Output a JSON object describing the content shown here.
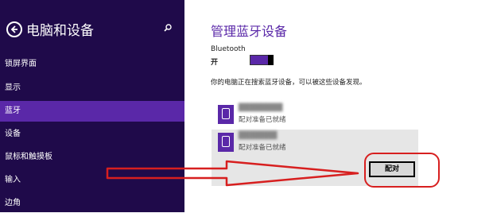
{
  "sidebar": {
    "title": "电脑和设备",
    "items": [
      {
        "label": "锁屏界面",
        "active": false
      },
      {
        "label": "显示",
        "active": false
      },
      {
        "label": "蓝牙",
        "active": true
      },
      {
        "label": "设备",
        "active": false
      },
      {
        "label": "鼠标和触摸板",
        "active": false
      },
      {
        "label": "输入",
        "active": false
      },
      {
        "label": "边角",
        "active": false
      }
    ]
  },
  "main": {
    "title": "管理蓝牙设备",
    "bluetooth_label": "Bluetooth",
    "bluetooth_state": "开",
    "status_text": "你的电脑正在搜索蓝牙设备，可以被这些设备发现。",
    "devices": [
      {
        "name": "████████",
        "status": "配对准备已就绪"
      },
      {
        "name": "███████",
        "status": "配对准备已就绪"
      }
    ],
    "pair_button_label": "配对"
  },
  "colors": {
    "sidebar_bg": "#1f0a4a",
    "accent": "#5a28a8",
    "annotation": "#d71f1f"
  }
}
